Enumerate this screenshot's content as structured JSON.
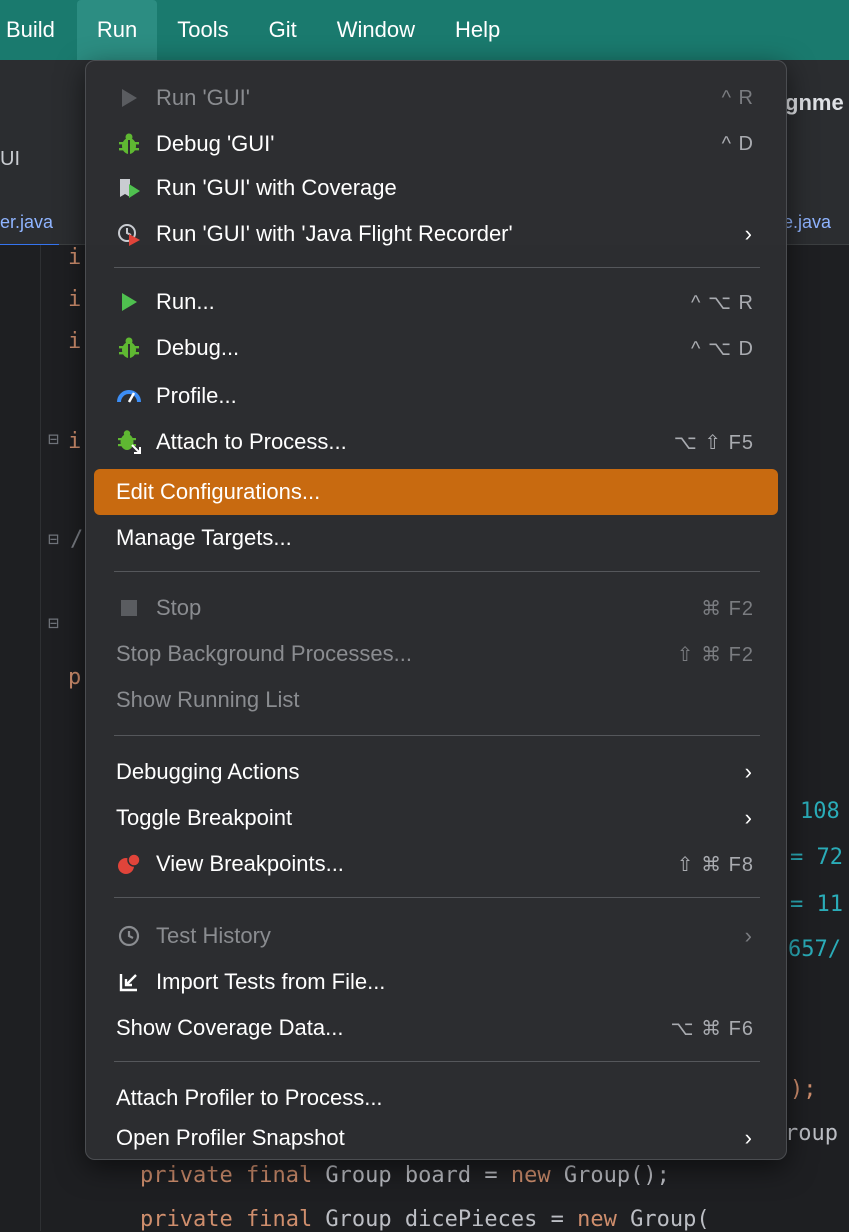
{
  "menubar": {
    "items": [
      "Build",
      "Run",
      "Tools",
      "Git",
      "Window",
      "Help"
    ]
  },
  "background": {
    "left_title": "UI",
    "right_title": "gnme",
    "tab_left": "er.java",
    "tab_right": "e.java",
    "code_lines": {
      "l1": "i",
      "l2": "i",
      "l3": "i",
      "l4": "i",
      "l5": "/",
      "l6": "p",
      "r1": "108",
      "r2": "= 72",
      "r3": "= 11",
      "r4": "657/",
      "r5": ");",
      "r6": "roup",
      "bottom1_kw": "private final",
      "bottom1_mid": " Group board = ",
      "bottom1_new": "new",
      "bottom1_end": " Group();",
      "bottom2_kw": "private final",
      "bottom2_mid": " Group dicePieces = ",
      "bottom2_new": "new",
      "bottom2_end": " Group("
    }
  },
  "menu": {
    "items": [
      {
        "label": "Run 'GUI'",
        "shortcut": "^ R",
        "icon": "run-icon",
        "disabled": true
      },
      {
        "label": "Debug 'GUI'",
        "shortcut": "^ D",
        "icon": "debug-icon"
      },
      {
        "label": "Run 'GUI' with Coverage",
        "shortcut": "",
        "icon": "coverage-icon"
      },
      {
        "label": "Run 'GUI' with 'Java Flight Recorder'",
        "shortcut": "",
        "icon": "flight-recorder-icon",
        "submenu": "›"
      },
      {
        "label": "Run...",
        "shortcut": "^ ⌥ R",
        "icon": "run-icon"
      },
      {
        "label": "Debug...",
        "shortcut": "^ ⌥ D",
        "icon": "debug-icon"
      },
      {
        "label": "Profile...",
        "shortcut": "",
        "icon": "profiler-gauge-icon"
      },
      {
        "label": "Attach to Process...",
        "shortcut": "⌥ ⇧ F5",
        "icon": "attach-debug-icon"
      },
      {
        "label": "Edit Configurations...",
        "shortcut": "",
        "highlighted": true
      },
      {
        "label": "Manage Targets...",
        "shortcut": ""
      },
      {
        "label": "Stop",
        "shortcut": "⌘ F2",
        "icon": "stop-icon",
        "disabled": true
      },
      {
        "label": "Stop Background Processes...",
        "shortcut": "⇧ ⌘ F2",
        "disabled": true
      },
      {
        "label": "Show Running List",
        "shortcut": "",
        "disabled": true
      },
      {
        "label": "Debugging Actions",
        "submenu": "›"
      },
      {
        "label": "Toggle Breakpoint",
        "submenu": "›"
      },
      {
        "label": "View Breakpoints...",
        "shortcut": "⇧ ⌘ F8",
        "icon": "breakpoints-icon"
      },
      {
        "label": "Test History",
        "icon": "history-clock-icon",
        "disabled": true,
        "submenu": "›"
      },
      {
        "label": "Import Tests from File...",
        "icon": "import-tests-icon"
      },
      {
        "label": "Show Coverage Data...",
        "shortcut": "⌥ ⌘ F6"
      },
      {
        "label": "Attach Profiler to Process..."
      },
      {
        "label": "Open Profiler Snapshot",
        "submenu": "›"
      }
    ]
  },
  "colors": {
    "menubar": "#1a7a6e",
    "highlight": "#c86a10",
    "run_green": "#4fc04f",
    "debug_green": "#5fb832",
    "breakpoint_red": "#e0443a"
  }
}
